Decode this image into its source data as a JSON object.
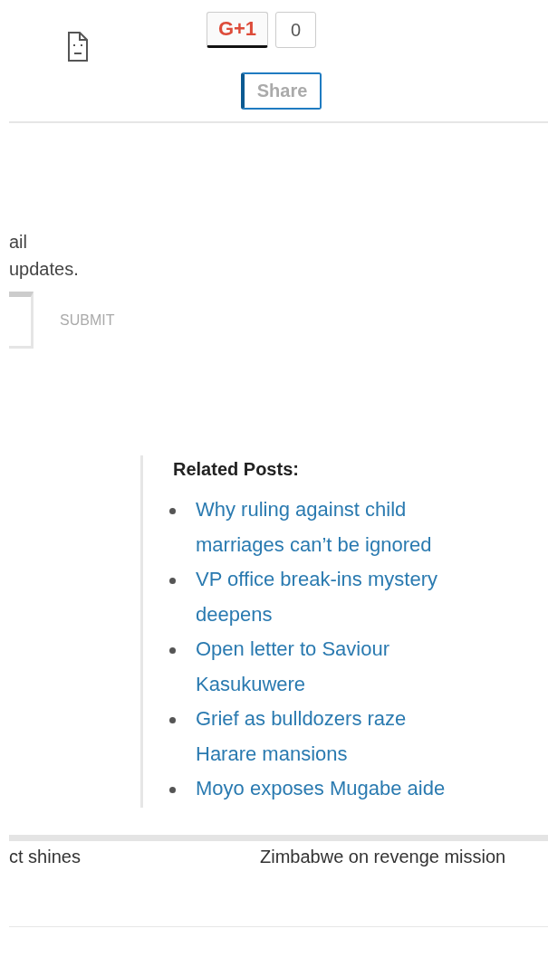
{
  "social": {
    "gplus_label": "G+1",
    "gplus_count": "0",
    "share_label": "Share"
  },
  "subscribe": {
    "lines": [
      "ail",
      "updates."
    ],
    "submit_label": "SUBMIT"
  },
  "related_posts": {
    "title": "Related Posts:",
    "items": [
      {
        "title": "Why ruling against child marriages can’t be ignored"
      },
      {
        "title": "VP office break-ins mystery deepens"
      },
      {
        "title": "Open letter to Saviour Kasukuwere"
      },
      {
        "title": "Grief as bulldozers raze Harare mansions"
      },
      {
        "title": "Moyo exposes Mugabe aide"
      }
    ]
  },
  "post_navigation": {
    "previous": "ct shines",
    "next": "Zimbabwe on revenge mission"
  }
}
